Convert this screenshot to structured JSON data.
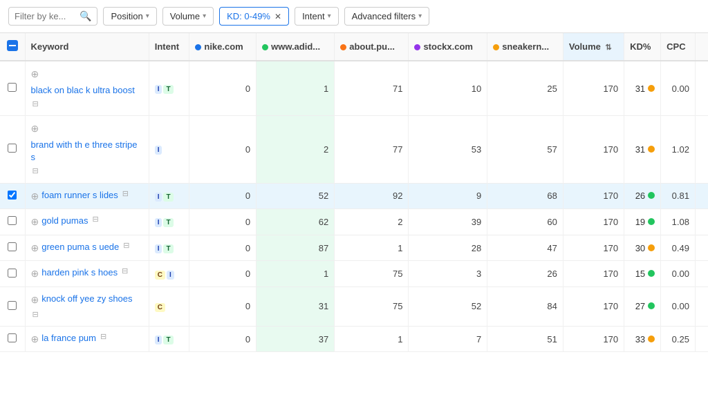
{
  "toolbar": {
    "search_placeholder": "Filter by ke...",
    "position_label": "Position",
    "volume_label": "Volume",
    "kd_label": "KD: 0-49%",
    "intent_label": "Intent",
    "advanced_filters_label": "Advanced filters"
  },
  "table": {
    "header_check": "select-all",
    "columns": [
      {
        "id": "keyword",
        "label": "Keyword"
      },
      {
        "id": "intent",
        "label": "Intent"
      },
      {
        "id": "nike",
        "label": "nike.com",
        "dot": "blue"
      },
      {
        "id": "adidas",
        "label": "www.adid...",
        "dot": "green"
      },
      {
        "id": "about",
        "label": "about.pu...",
        "dot": "orange"
      },
      {
        "id": "stockx",
        "label": "stockx.com",
        "dot": "purple"
      },
      {
        "id": "sneakern",
        "label": "sneakern...",
        "dot": "yellow"
      },
      {
        "id": "volume",
        "label": "Volume",
        "sorted": true
      },
      {
        "id": "kd",
        "label": "KD%"
      },
      {
        "id": "cpc",
        "label": "CPC"
      },
      {
        "id": "extra",
        "label": ""
      }
    ],
    "rows": [
      {
        "id": 1,
        "checked": false,
        "keyword": "black on black ultra boost",
        "keyword_short": "black on blac k ultra boost",
        "intent": [
          {
            "code": "I",
            "type": "I"
          },
          {
            "code": "T",
            "type": "T"
          }
        ],
        "nike": "0",
        "adidas": "1",
        "about": "71",
        "stockx": "10",
        "sneakern": "25",
        "volume": "170",
        "kd": "31",
        "kd_dot": "yellow",
        "cpc": "0.00",
        "adidas_green": true,
        "selected": false
      },
      {
        "id": 2,
        "checked": false,
        "keyword": "brand with the three stripes",
        "keyword_short": "brand with th e three stripe s",
        "intent": [
          {
            "code": "I",
            "type": "I"
          }
        ],
        "nike": "0",
        "adidas": "2",
        "about": "77",
        "stockx": "53",
        "sneakern": "57",
        "volume": "170",
        "kd": "31",
        "kd_dot": "yellow",
        "cpc": "1.02",
        "adidas_green": true,
        "selected": false
      },
      {
        "id": 3,
        "checked": true,
        "keyword": "foam runner slides",
        "keyword_short": "foam runner s lides",
        "intent": [
          {
            "code": "I",
            "type": "I"
          },
          {
            "code": "T",
            "type": "T"
          }
        ],
        "nike": "0",
        "adidas": "52",
        "about": "92",
        "stockx": "9",
        "sneakern": "68",
        "volume": "170",
        "kd": "26",
        "kd_dot": "green",
        "cpc": "0.81",
        "adidas_green": false,
        "selected": true
      },
      {
        "id": 4,
        "checked": false,
        "keyword": "gold pumas",
        "keyword_short": "gold pumas",
        "intent": [
          {
            "code": "I",
            "type": "I"
          },
          {
            "code": "T",
            "type": "T"
          }
        ],
        "nike": "0",
        "adidas": "62",
        "about": "2",
        "stockx": "39",
        "sneakern": "60",
        "volume": "170",
        "kd": "19",
        "kd_dot": "green",
        "cpc": "1.08",
        "adidas_green": true,
        "selected": false
      },
      {
        "id": 5,
        "checked": false,
        "keyword": "green puma suede",
        "keyword_short": "green puma s uede",
        "intent": [
          {
            "code": "I",
            "type": "I"
          },
          {
            "code": "T",
            "type": "T"
          }
        ],
        "nike": "0",
        "adidas": "87",
        "about": "1",
        "stockx": "28",
        "sneakern": "47",
        "volume": "170",
        "kd": "30",
        "kd_dot": "yellow",
        "cpc": "0.49",
        "adidas_green": true,
        "selected": false
      },
      {
        "id": 6,
        "checked": false,
        "keyword": "harden pink shoes",
        "keyword_short": "harden pink s hoes",
        "intent": [
          {
            "code": "C",
            "type": "C"
          },
          {
            "code": "I",
            "type": "I"
          }
        ],
        "nike": "0",
        "adidas": "1",
        "about": "75",
        "stockx": "3",
        "sneakern": "26",
        "volume": "170",
        "kd": "15",
        "kd_dot": "green",
        "cpc": "0.00",
        "adidas_green": true,
        "selected": false
      },
      {
        "id": 7,
        "checked": false,
        "keyword": "knock off yeezy shoes",
        "keyword_short": "knock off yee zy shoes",
        "intent": [
          {
            "code": "C",
            "type": "C"
          }
        ],
        "nike": "0",
        "adidas": "31",
        "about": "75",
        "stockx": "52",
        "sneakern": "84",
        "volume": "170",
        "kd": "27",
        "kd_dot": "green",
        "cpc": "0.00",
        "adidas_green": true,
        "selected": false
      },
      {
        "id": 8,
        "checked": false,
        "keyword": "la france pum",
        "keyword_short": "la france pum",
        "intent": [
          {
            "code": "I",
            "type": "I"
          },
          {
            "code": "T",
            "type": "T"
          }
        ],
        "nike": "0",
        "adidas": "37",
        "about": "1",
        "stockx": "7",
        "sneakern": "51",
        "volume": "170",
        "kd": "33",
        "kd_dot": "yellow",
        "cpc": "0.25",
        "adidas_green": true,
        "selected": false
      }
    ]
  }
}
